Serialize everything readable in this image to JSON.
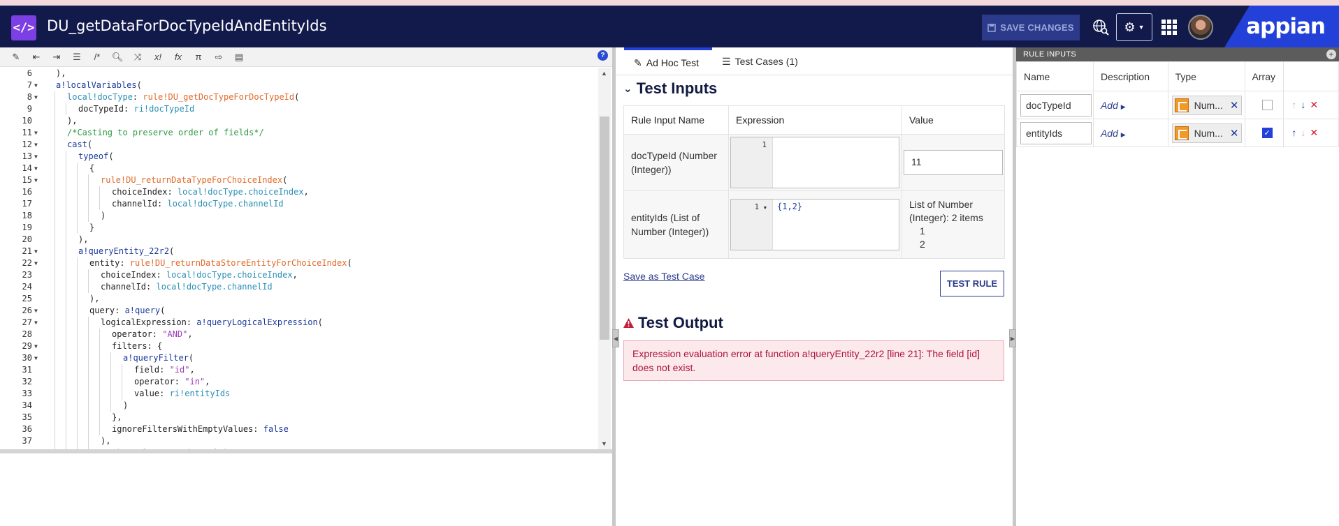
{
  "header": {
    "title": "DU_getDataForDocTypeIdAndEntityIds",
    "save_label": "SAVE CHANGES",
    "brand": "appian"
  },
  "editor": {
    "lines": [
      {
        "n": "6",
        "fold": false,
        "indent": 1,
        "html": "),"
      },
      {
        "n": "7",
        "fold": true,
        "indent": 1,
        "html": "<span class='k'>a!localVariables</span>("
      },
      {
        "n": "8",
        "fold": true,
        "indent": 2,
        "html": "<span class='lv'>local!docType</span>: <span class='r'>rule!DU_getDocTypeForDocTypeId</span>("
      },
      {
        "n": "9",
        "fold": false,
        "indent": 3,
        "html": "docTypeId: <span class='ri'>ri!docTypeId</span>"
      },
      {
        "n": "10",
        "fold": false,
        "indent": 2,
        "html": "),"
      },
      {
        "n": "11",
        "fold": true,
        "indent": 2,
        "html": "<span class='c'>/*Casting to preserve order of fields*/</span>"
      },
      {
        "n": "12",
        "fold": true,
        "indent": 2,
        "html": "<span class='k'>cast</span>("
      },
      {
        "n": "13",
        "fold": true,
        "indent": 3,
        "html": "<span class='k'>typeof</span>("
      },
      {
        "n": "14",
        "fold": true,
        "indent": 4,
        "html": "{"
      },
      {
        "n": "15",
        "fold": true,
        "indent": 5,
        "html": "<span class='r'>rule!DU_returnDataTypeForChoiceIndex</span>("
      },
      {
        "n": "16",
        "fold": false,
        "indent": 6,
        "html": "choiceIndex: <span class='lv'>local!docType.choiceIndex</span>,"
      },
      {
        "n": "17",
        "fold": false,
        "indent": 6,
        "html": "channelId: <span class='lv'>local!docType.channelId</span>"
      },
      {
        "n": "18",
        "fold": false,
        "indent": 5,
        "html": ")"
      },
      {
        "n": "19",
        "fold": false,
        "indent": 4,
        "html": "}"
      },
      {
        "n": "20",
        "fold": false,
        "indent": 3,
        "html": "),"
      },
      {
        "n": "21",
        "fold": true,
        "indent": 3,
        "html": "<span class='k'>a!queryEntity_22r2</span>("
      },
      {
        "n": "22",
        "fold": true,
        "indent": 4,
        "html": "entity: <span class='r'>rule!DU_returnDataStoreEntityForChoiceIndex</span>("
      },
      {
        "n": "23",
        "fold": false,
        "indent": 5,
        "html": "choiceIndex: <span class='lv'>local!docType.choiceIndex</span>,"
      },
      {
        "n": "24",
        "fold": false,
        "indent": 5,
        "html": "channelId: <span class='lv'>local!docType.channelId</span>"
      },
      {
        "n": "25",
        "fold": false,
        "indent": 4,
        "html": "),"
      },
      {
        "n": "26",
        "fold": true,
        "indent": 4,
        "html": "query: <span class='k'>a!query</span>("
      },
      {
        "n": "27",
        "fold": true,
        "indent": 5,
        "html": "logicalExpression: <span class='k'>a!queryLogicalExpression</span>("
      },
      {
        "n": "28",
        "fold": false,
        "indent": 6,
        "html": "operator: <span class='s'>\"AND\"</span>,"
      },
      {
        "n": "29",
        "fold": true,
        "indent": 6,
        "html": "filters: {"
      },
      {
        "n": "30",
        "fold": true,
        "indent": 7,
        "html": "<span class='k'>a!queryFilter</span>("
      },
      {
        "n": "31",
        "fold": false,
        "indent": 8,
        "html": "field: <span class='s'>\"id\"</span>,"
      },
      {
        "n": "32",
        "fold": false,
        "indent": 8,
        "html": "operator: <span class='s'>\"in\"</span>,"
      },
      {
        "n": "33",
        "fold": false,
        "indent": 8,
        "html": "value: <span class='ri'>ri!entityIds</span>"
      },
      {
        "n": "34",
        "fold": false,
        "indent": 7,
        "html": ")"
      },
      {
        "n": "35",
        "fold": false,
        "indent": 6,
        "html": "},"
      },
      {
        "n": "36",
        "fold": false,
        "indent": 6,
        "html": "ignoreFiltersWithEmptyValues: <span class='kw'>false</span>"
      },
      {
        "n": "37",
        "fold": false,
        "indent": 5,
        "html": "),"
      },
      {
        "n": "",
        "fold": false,
        "indent": 5,
        "html": "<span class='f'>pagingInfo: a!pagingInfo(</span>"
      }
    ]
  },
  "tabs": {
    "adhoc": "Ad Hoc Test",
    "cases": "Test Cases (1)"
  },
  "test_inputs": {
    "title": "Test Inputs",
    "col_name": "Rule Input Name",
    "col_expr": "Expression",
    "col_value": "Value",
    "rows": [
      {
        "name": "docTypeId (Number (Integer))",
        "line": "1",
        "expr": "",
        "value": "11"
      },
      {
        "name": "entityIds (List of Number (Integer))",
        "line": "1",
        "expr": "{1,2}",
        "value_text": "List of Number (Integer): 2 items",
        "items": [
          "1",
          "2"
        ]
      }
    ],
    "save_link": "Save as Test Case",
    "test_button": "TEST RULE"
  },
  "test_output": {
    "title": "Test Output",
    "error": "Expression evaluation error at function a!queryEntity_22r2 [line 21]: The field [id] does not exist."
  },
  "rule_inputs": {
    "header": "RULE INPUTS",
    "col_name": "Name",
    "col_desc": "Description",
    "col_type": "Type",
    "col_array": "Array",
    "rows": [
      {
        "name": "docTypeId",
        "desc": "Add",
        "type": "Num...",
        "array": false,
        "up_enabled": false,
        "down_enabled": true
      },
      {
        "name": "entityIds",
        "desc": "Add",
        "type": "Num...",
        "array": true,
        "up_enabled": true,
        "down_enabled": false
      }
    ]
  }
}
